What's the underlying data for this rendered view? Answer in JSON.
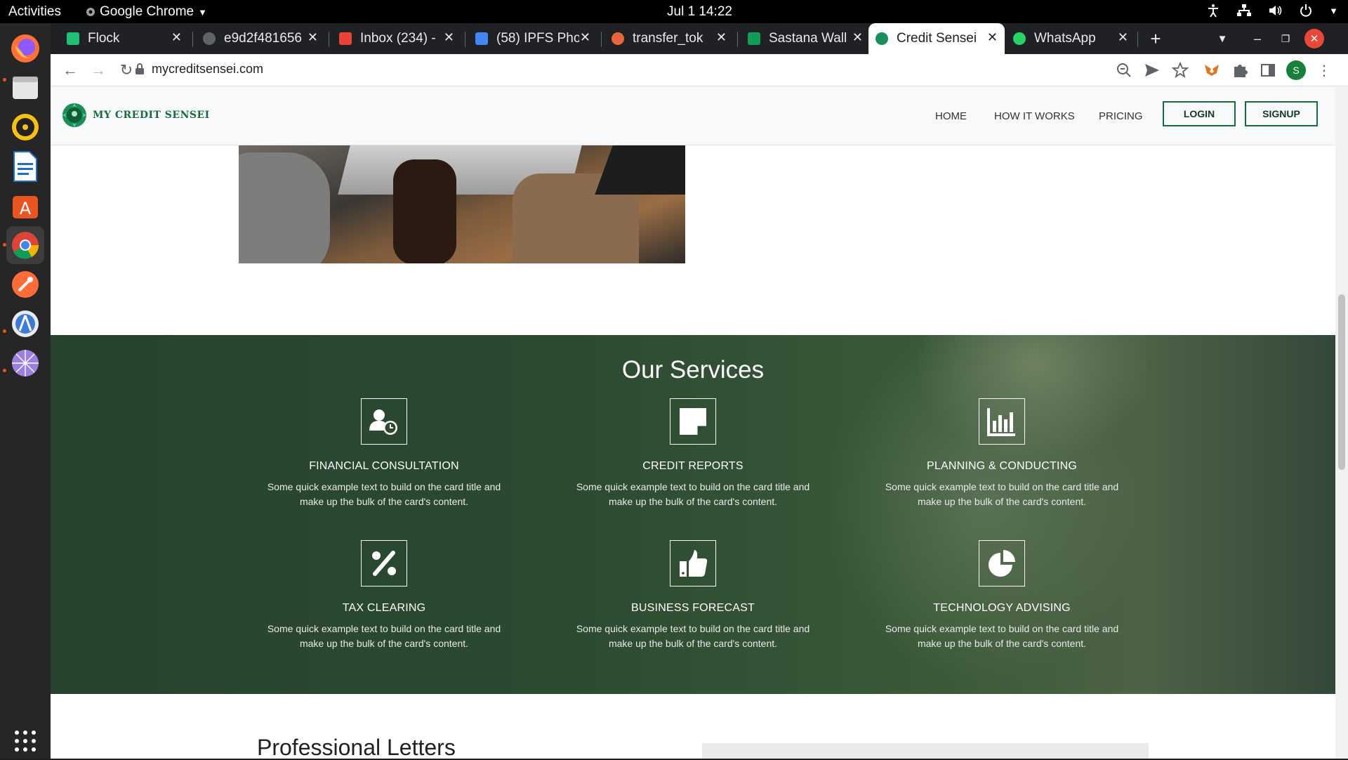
{
  "system": {
    "activities": "Activities",
    "app_name": "Google Chrome",
    "clock": "Jul 1  14:22"
  },
  "browser": {
    "tabs": [
      {
        "title": "Flock",
        "icon": "flock-icon",
        "color": "#1fbf76"
      },
      {
        "title": "e9d2f481656",
        "icon": "globe-icon",
        "color": "#5f6368"
      },
      {
        "title": "Inbox (234) -",
        "icon": "gmail-icon",
        "color": "#ea4335"
      },
      {
        "title": "(58) IPFS Pho",
        "icon": "checkbox-icon",
        "color": "#4285f4"
      },
      {
        "title": "transfer_tok",
        "icon": "transfer-icon",
        "color": "#e8643c"
      },
      {
        "title": "Sastana Wall",
        "icon": "plus-doc-icon",
        "color": "#0f9d58"
      },
      {
        "title": "Credit Sensei",
        "icon": "credit-sensei-icon",
        "color": "#1b8f5a"
      },
      {
        "title": "WhatsApp",
        "icon": "whatsapp-icon",
        "color": "#25d366"
      }
    ],
    "active_tab": 6,
    "url": "mycreditsensei.com",
    "profile_initial": "S"
  },
  "site": {
    "logo_text": "MY CREDIT SENSEI",
    "nav": {
      "home": "HOME",
      "how_it_works": "HOW IT WORKS",
      "pricing": "PRICING",
      "login": "LOGIN",
      "signup": "SIGNUP"
    },
    "services_title": "Our Services",
    "services": [
      {
        "title": "FINANCIAL CONSULTATION",
        "desc": "Some quick example text to build on the card title and make up the bulk of the card's content.",
        "icon": "user-clock-icon"
      },
      {
        "title": "CREDIT REPORTS",
        "desc": "Some quick example text to build on the card title and make up the bulk of the card's content.",
        "icon": "sticky-note-icon"
      },
      {
        "title": "PLANNING & CONDUCTING",
        "desc": "Some quick example text to build on the card title and make up the bulk of the card's content.",
        "icon": "bar-chart-icon"
      },
      {
        "title": "TAX CLEARING",
        "desc": "Some quick example text to build on the card title and make up the bulk of the card's content.",
        "icon": "percent-icon"
      },
      {
        "title": "BUSINESS FORECAST",
        "desc": "Some quick example text to build on the card title and make up the bulk of the card's content.",
        "icon": "thumbs-up-icon"
      },
      {
        "title": "TECHNOLOGY ADVISING",
        "desc": "Some quick example text to build on the card title and make up the bulk of the card's content.",
        "icon": "pie-chart-icon"
      }
    ],
    "next_section_title": "Professional Letters"
  },
  "colors": {
    "brand_green": "#186b3e",
    "services_bg": "#2b4a30"
  }
}
